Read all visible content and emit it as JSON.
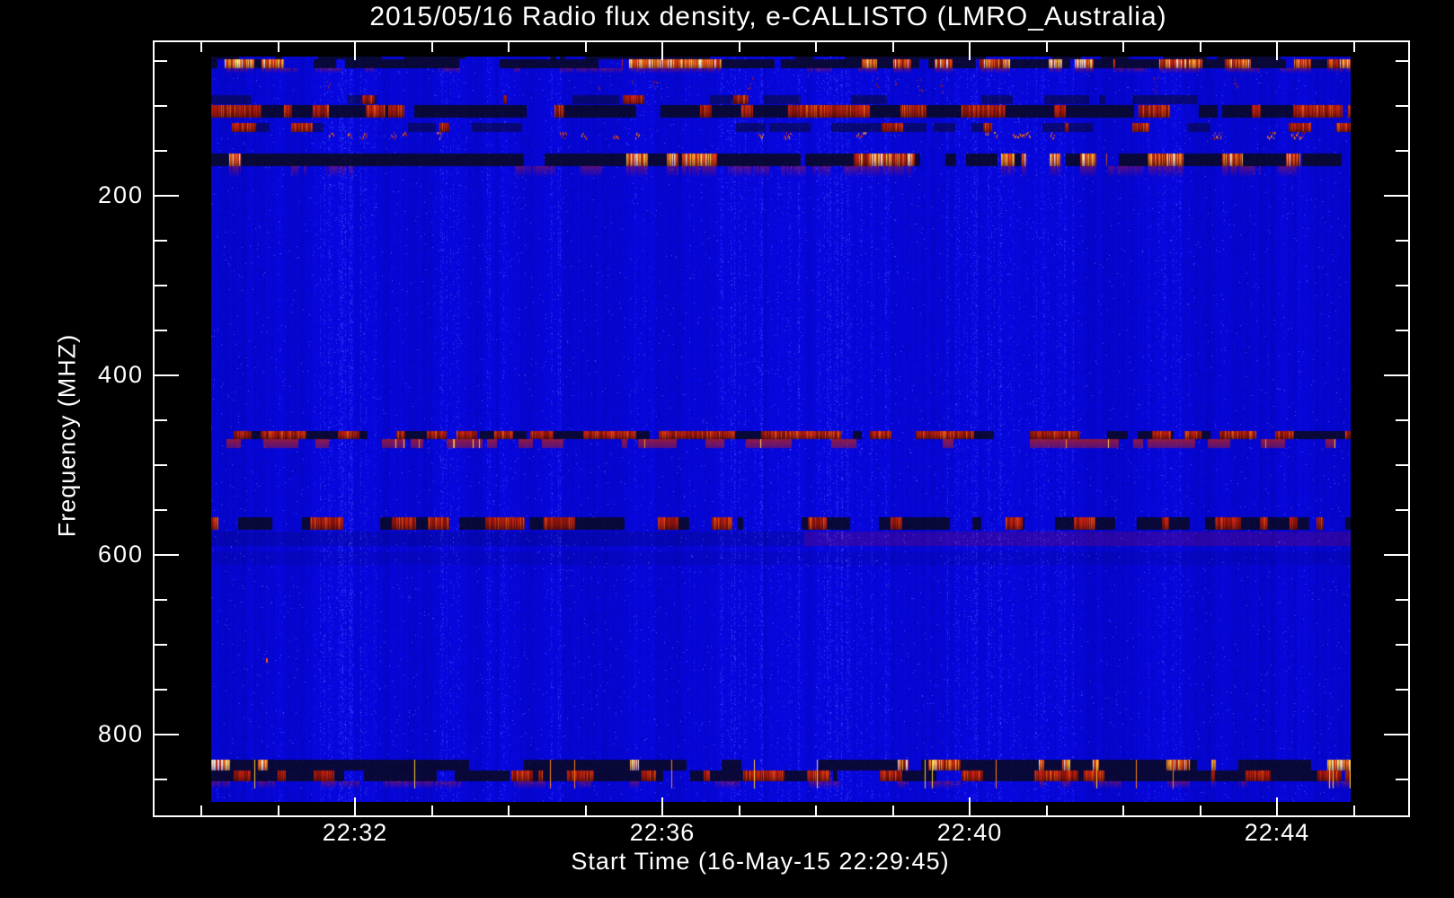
{
  "title": "2015/05/16  Radio flux density, e-CALLISTO (LMRO_Australia)",
  "colors": {
    "background": "#000000",
    "foreground": "#ffffff",
    "base_blue": "#0202dd"
  },
  "chart_data": {
    "type": "heatmap",
    "title": "2015/05/16  Radio flux density, e-CALLISTO (LMRO_Australia)",
    "xlabel": "Start Time (16-May-15 22:29:45)",
    "ylabel": "Frequency (MHZ)",
    "date": "2015/05/16",
    "instrument": "e-CALLISTO",
    "station": "LMRO_Australia",
    "start_time": "22:29:45",
    "x_range": [
      "22:29:45",
      "22:45:00"
    ],
    "y_range_mhz": [
      45,
      870
    ],
    "y_axis_inverted": true,
    "legend_position": "none",
    "grid": false,
    "x_major_ticks": [
      {
        "label": "22:32",
        "min_after_2230": 2
      },
      {
        "label": "22:36",
        "min_after_2230": 6
      },
      {
        "label": "22:40",
        "min_after_2230": 10
      },
      {
        "label": "22:44",
        "min_after_2230": 14
      }
    ],
    "x_minor_ticks_min_after_2230": [
      0,
      1,
      3,
      4,
      5,
      7,
      8,
      9,
      11,
      12,
      13,
      15
    ],
    "y_major_ticks": [
      {
        "label": "200",
        "mhz": 200
      },
      {
        "label": "400",
        "mhz": 400
      },
      {
        "label": "600",
        "mhz": 600
      },
      {
        "label": "800",
        "mhz": 800
      }
    ],
    "y_minor_ticks_mhz": [
      50,
      100,
      150,
      250,
      300,
      350,
      450,
      500,
      550,
      650,
      700,
      750,
      850
    ],
    "colormap": {
      "low": "#0202dd",
      "mid_red": "#cc2200",
      "orange": "#ff8810",
      "high_yellow": "#ffd746",
      "peak_white": "#fff8d7",
      "rfi_dark": "#06061e"
    },
    "background_description": "quiet solar radio continuum, saturated blue with vertical noise striping",
    "rfi_bands": [
      {
        "f": [
          45,
          48
        ],
        "style": "dark",
        "coverage": 0.55,
        "description": "dark edge row at top of data (45 MHz)"
      },
      {
        "f": [
          48,
          58
        ],
        "style": "hot",
        "coverage": 0.5,
        "white_bias": 0.06,
        "description": "intermittent strong RFI band ~50 MHz, red/orange/yellow bursts"
      },
      {
        "f": [
          58,
          63
        ],
        "style": "echo",
        "coverage": 0.5,
        "description": "faint red smear under 50 MHz band"
      },
      {
        "f": [
          68,
          86
        ],
        "style": "speckle",
        "coverage": 0.045,
        "description": "sparse red speckle 70-85 MHz"
      },
      {
        "f": [
          88,
          98
        ],
        "style": "darkfaint",
        "coverage": 0.4,
        "red": 0.08,
        "description": "faint dashed interference line ~93 MHz"
      },
      {
        "f": [
          99,
          113
        ],
        "style": "darkred",
        "coverage": 0.8,
        "red": 0.4,
        "description": "FM broadcast band RFI ~100-112 MHz, dark lane with red dashes"
      },
      {
        "f": [
          119,
          129
        ],
        "style": "darkfaint",
        "coverage": 0.38,
        "red": 0.12,
        "description": "faint dashed line ~124 MHz"
      },
      {
        "f": [
          129,
          138
        ],
        "style": "blobs",
        "coverage": 0.09,
        "description": "sparse red/orange blobs ~133 MHz"
      },
      {
        "f": [
          153,
          167
        ],
        "style": "hot",
        "coverage": 0.42,
        "white_bias": 0.04,
        "description": "intermittent strong RFI band ~160 MHz"
      },
      {
        "f": [
          167,
          179
        ],
        "style": "echo",
        "coverage": 0.42,
        "description": "red/purple smear under 160 MHz band"
      },
      {
        "f": [
          462,
          471
        ],
        "style": "darkred",
        "coverage": 0.6,
        "red": 0.5,
        "description": "UHF RFI line ~465 MHz, dark with bright red dashes"
      },
      {
        "f": [
          471,
          481
        ],
        "style": "redsmear",
        "coverage": 0.4,
        "description": "red smears with occasional orange/yellow bursts ~475 MHz"
      },
      {
        "f": [
          558,
          572
        ],
        "style": "darkred",
        "coverage": 0.7,
        "red": 0.28,
        "description": "dashed dark line ~565 MHz"
      },
      {
        "f": [
          574,
          590
        ],
        "style": "wash",
        "factor": 0.86,
        "purple_right": true,
        "description": "slightly darker band ~580 MHz with purple tinge on right half"
      },
      {
        "f": [
          596,
          611
        ],
        "style": "wash",
        "factor": 0.92,
        "description": "subtle darker band ~600 MHz"
      },
      {
        "f": [
          828,
          840
        ],
        "style": "hot",
        "coverage": 0.38,
        "white_bias": 0.3,
        "description": "intermittent strong RFI ~834 MHz with white-hot segments"
      },
      {
        "f": [
          840,
          852
        ],
        "style": "darkred",
        "coverage": 0.85,
        "red": 0.4,
        "yellow_ticks": true,
        "description": "dark lane with red bursts ~846 MHz and thin yellow tick lines"
      },
      {
        "f": [
          852,
          860
        ],
        "style": "echo",
        "coverage": 0.35,
        "description": "faint red smear ~856 MHz"
      }
    ],
    "point_events": [
      {
        "time_frac": 0.048,
        "mhz": 717,
        "color": "#ff5a00",
        "description": "isolated narrowband burst pixel"
      }
    ]
  }
}
